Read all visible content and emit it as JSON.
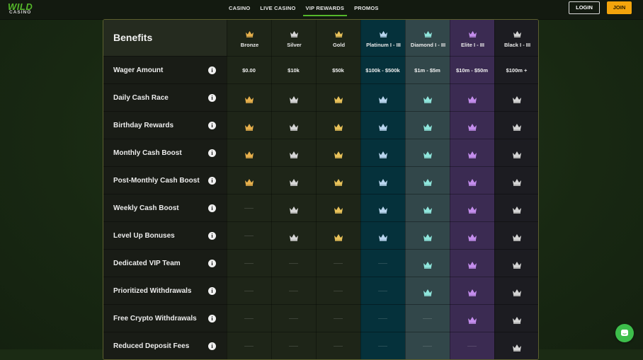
{
  "header": {
    "logo_top": "WILD",
    "logo_bottom": "CASINO",
    "nav": [
      "CASINO",
      "LIVE CASINO",
      "VIP REWARDS",
      "PROMOS"
    ],
    "active_nav": "VIP REWARDS",
    "login_label": "LOGIN",
    "join_label": "JOIN"
  },
  "table": {
    "title": "Benefits",
    "tiers": [
      {
        "name": "Bronze",
        "color": "#e7b04c",
        "bg": "#1e2518"
      },
      {
        "name": "Silver",
        "color": "#d6d6d6",
        "bg": "#1e2518"
      },
      {
        "name": "Gold",
        "color": "#e9c25a",
        "bg": "#1e2518"
      },
      {
        "name": "Platinum I - III",
        "color": "#b9d5ee",
        "bg": "#05313b"
      },
      {
        "name": "Diamond I - III",
        "color": "#8fe6dc",
        "bg": "#32474a"
      },
      {
        "name": "Elite I - III",
        "color": "#c48ded",
        "bg": "#3b2b52"
      },
      {
        "name": "Black I - III",
        "color": "#d4d4d4",
        "bg": "#1c1c21"
      }
    ],
    "rows": [
      {
        "label": "Wager Amount",
        "values": [
          "$0.00",
          "$10k",
          "$50k",
          "$100k - $500k",
          "$1m - $5m",
          "$10m - $50m",
          "$100m +"
        ]
      },
      {
        "label": "Daily Cash Race",
        "values": [
          true,
          true,
          true,
          true,
          true,
          true,
          true
        ]
      },
      {
        "label": "Birthday Rewards",
        "values": [
          true,
          true,
          true,
          true,
          true,
          true,
          true
        ]
      },
      {
        "label": "Monthly Cash Boost",
        "values": [
          true,
          true,
          true,
          true,
          true,
          true,
          true
        ]
      },
      {
        "label": "Post-Monthly Cash Boost",
        "values": [
          true,
          true,
          true,
          true,
          true,
          true,
          true
        ]
      },
      {
        "label": "Weekly Cash Boost",
        "values": [
          false,
          true,
          true,
          true,
          true,
          true,
          true
        ]
      },
      {
        "label": "Level Up Bonuses",
        "values": [
          false,
          true,
          true,
          true,
          true,
          true,
          true
        ]
      },
      {
        "label": "Dedicated VIP Team",
        "values": [
          false,
          false,
          false,
          false,
          true,
          true,
          true
        ]
      },
      {
        "label": "Prioritized Withdrawals",
        "values": [
          false,
          false,
          false,
          false,
          true,
          true,
          true
        ]
      },
      {
        "label": "Free Crypto Withdrawals",
        "values": [
          false,
          false,
          false,
          false,
          false,
          true,
          true
        ]
      },
      {
        "label": "Reduced Deposit Fees",
        "values": [
          false,
          false,
          false,
          false,
          false,
          false,
          true
        ]
      }
    ]
  },
  "chat_icon": "chat-bubble-icon"
}
